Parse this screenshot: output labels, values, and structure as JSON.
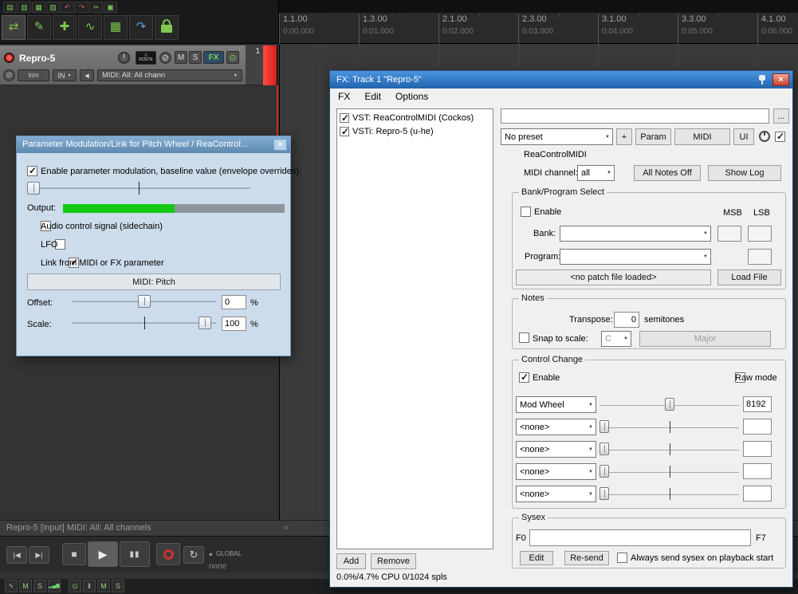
{
  "toolbar": {
    "row1": [
      {
        "name": "new-project-icon",
        "glyph": "▤"
      },
      {
        "name": "open-project-icon",
        "glyph": "▥"
      },
      {
        "name": "save-project-icon",
        "glyph": "▦"
      },
      {
        "name": "project-settings-icon",
        "glyph": "▨"
      },
      {
        "name": "undo-icon",
        "glyph": "↶"
      },
      {
        "name": "redo-icon",
        "glyph": "↷"
      },
      {
        "name": "item-split-icon",
        "glyph": "✂"
      },
      {
        "name": "item-group-icon",
        "glyph": "▣"
      }
    ],
    "row2": [
      {
        "name": "envelope-mode-icon",
        "glyph": "⇄"
      },
      {
        "name": "pencil-draw-icon",
        "glyph": "✎"
      },
      {
        "name": "hand-scroll-icon",
        "glyph": "✚"
      },
      {
        "name": "edit-cursor-wave-icon",
        "glyph": "∿"
      },
      {
        "name": "grid-snap-icon",
        "glyph": "▦"
      },
      {
        "name": "smooth-curve-icon",
        "glyph": "↷"
      }
    ]
  },
  "timeline": {
    "marks": [
      {
        "bar": "1.1.00",
        "time": "0:00.000"
      },
      {
        "bar": "1.3.00",
        "time": "0:01.000"
      },
      {
        "bar": "2.1.00",
        "time": "0:02.000"
      },
      {
        "bar": "2.3.00",
        "time": "0:03.000"
      },
      {
        "bar": "3.1.00",
        "time": "0:04.000"
      },
      {
        "bar": "3.3.00",
        "time": "0:05.000"
      },
      {
        "bar": "4.1.00",
        "time": "0:06.000"
      }
    ]
  },
  "track": {
    "name": "Repro-5",
    "number": "1",
    "route": "ROUTE",
    "route_dots": "⠿",
    "phase": "⊘",
    "mute": "M",
    "solo": "S",
    "fx": "FX",
    "power": "⊙",
    "polarity": "⊘",
    "trim": "trim",
    "input": "IN",
    "input_arrow": "▼",
    "speaker": "◀",
    "midi_input": "MIDI: All: All chann",
    "midi_arrow": "▼"
  },
  "status_bar": {
    "text": "Repro-5 [input] MIDI: All: All channels",
    "docker": "«"
  },
  "transport": {
    "prev": "|◀",
    "next": "▶|",
    "stop": "■",
    "play": "▶",
    "pause": "▮▮",
    "loop": "↻",
    "global_icon": "◆",
    "global_label": "GLOBAL",
    "global_value": "none"
  },
  "mini_strip": {
    "tiles": [
      "∿",
      "M",
      "S",
      "▂▄▆",
      "⊙",
      "‖",
      "M",
      "S"
    ]
  },
  "param_dialog": {
    "title": "Parameter Modulation/Link for Pitch Wheel / ReaControl...",
    "close": "×",
    "enable_label": "Enable parameter modulation, baseline value (envelope overrides):",
    "output_label": "Output:",
    "sidechain_label": "Audio control signal (sidechain)",
    "lfo_label": "LFO",
    "link_label": "Link from MIDI or FX parameter",
    "link_button": "MIDI: Pitch",
    "offset_label": "Offset:",
    "offset_value": "0",
    "offset_unit": "%",
    "scale_label": "Scale:",
    "scale_value": "100",
    "scale_unit": "%"
  },
  "fx": {
    "title": "FX: Track 1 \"Repro-5\"",
    "close": "×",
    "menu": {
      "fx": "FX",
      "edit": "Edit",
      "options": "Options"
    },
    "chain": [
      {
        "label": "VST: ReaControlMIDI (Cockos)"
      },
      {
        "label": "VSTi: Repro-5 (u-he)"
      }
    ],
    "add": "Add",
    "remove": "Remove",
    "cpu_status": "0.0%/4.7% CPU 0/1024 spls",
    "name_field": "",
    "more_button": "...",
    "preset": {
      "value": "No preset",
      "plus": "+",
      "param": "Param",
      "io": "MIDI",
      "ui": "UI"
    },
    "plugin_title": "ReaControlMIDI",
    "midi_channel": {
      "label": "MIDI channel:",
      "value": "all",
      "all_notes_off": "All Notes Off",
      "show_log": "Show Log"
    },
    "bank": {
      "title": "Bank/Program Select",
      "enable": "Enable",
      "msb": "MSB",
      "lsb": "LSB",
      "bank_label": "Bank:",
      "program_label": "Program:",
      "patch": "<no patch file loaded>",
      "load": "Load File"
    },
    "notes": {
      "title": "Notes",
      "transpose_label": "Transpose:",
      "transpose_value": "0",
      "transpose_unit": "semitones",
      "snap_label": "Snap to scale:",
      "key": "C",
      "scale_name": "Major"
    },
    "cc": {
      "title": "Control Change",
      "enable": "Enable",
      "raw": "Raw mode",
      "rows": [
        {
          "name": "Mod Wheel",
          "value": "8192"
        },
        {
          "name": "<none>",
          "value": ""
        },
        {
          "name": "<none>",
          "value": ""
        },
        {
          "name": "<none>",
          "value": ""
        },
        {
          "name": "<none>",
          "value": ""
        }
      ]
    },
    "sysex": {
      "title": "Sysex",
      "f0": "F0",
      "f7": "F7",
      "field": "",
      "edit": "Edit",
      "resend": "Re-send",
      "always": "Always send sysex on playback start"
    }
  }
}
